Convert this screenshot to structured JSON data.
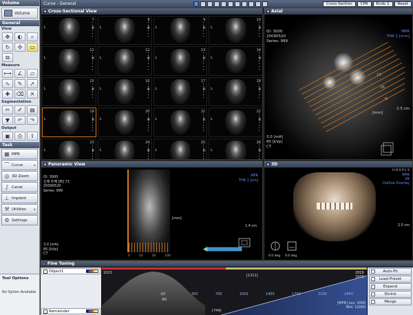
{
  "left_panel": {
    "volume_header": "Volume",
    "volume_button": "Volume",
    "general_header": "General",
    "view_label": "View",
    "measure_label": "Measure",
    "segmentation_label": "Segmentation",
    "output_label": "Output",
    "task_header": "Task",
    "tasks": [
      {
        "label": "MPR"
      },
      {
        "label": "Curve"
      },
      {
        "label": "3D Zoom"
      },
      {
        "label": "Canal"
      },
      {
        "label": "Implant"
      },
      {
        "label": "Utilities"
      },
      {
        "label": "Settings"
      }
    ],
    "tool_options_title": "Tool Options",
    "tool_options_text": "No Option Available"
  },
  "topbar": {
    "title": "Curve - General",
    "mode_buttons": [
      "Cross-Section",
      "CPR",
      "Endo 1",
      "Reset"
    ]
  },
  "cross_section": {
    "title": "Cross-Sectional View",
    "numbers": [
      "7",
      "8",
      "9",
      "10",
      "11",
      "12",
      "13",
      "14",
      "15",
      "16",
      "17",
      "18",
      "19",
      "20",
      "21",
      "22",
      "23",
      "24",
      "25",
      "26"
    ],
    "left_label": "L",
    "right_label": "B"
  },
  "axial": {
    "title": "Axial",
    "id_line": "ID: 3000",
    "date_line": "20090520",
    "series_line": "Series: 999",
    "mpr": "MPR",
    "thk": "THK 1 [mm]",
    "mm": "[mm]",
    "scale": "2.5 cm",
    "ma": "3.0 [mA]",
    "kvp": "85 [kVp]",
    "ct": "CT",
    "slice_numbers": [
      "16",
      "36",
      "N"
    ]
  },
  "panoramic": {
    "title": "Panoramic View",
    "id_line": "ID: 3000",
    "name_line": "신체 두께 [M] 73",
    "date_line": "20090520",
    "series_line": "Series: 999",
    "mpr": "MPR",
    "thk": "THK 1 [cm]",
    "mm": "[mm]",
    "scale": "1.4 cm",
    "ma": "3.0 [mA]",
    "kvp": "85 [kVp]",
    "ct": "CT",
    "ruler_ticks": [
      "0",
      "10",
      "20",
      "100"
    ]
  },
  "vr": {
    "title": "3D",
    "header_right": "H R A P L S",
    "mpr": "MPR",
    "thk": "VR",
    "overlay": "Outline Overlay",
    "scale": "2.5 cm",
    "angle_a": "0.0 deg",
    "angle_b": "0.0 deg"
  },
  "fine_tuning": {
    "title": "Fine Tuning",
    "object": "Object1",
    "remainder": "Remainder",
    "window_top_left": "1023",
    "window_top_center": "[1311]",
    "window_top_right": "2829",
    "window_right_top": "2000",
    "peak_values": [
      "-20",
      "-80"
    ],
    "axis_ticks": [
      "350",
      "700",
      "1050",
      "1400",
      "1750",
      "2100",
      "2450"
    ],
    "bottom_center": "[744]",
    "level_line": "[MPR] Lev: 3000",
    "width_line": "Wid: 12000",
    "buttons": [
      "Auto-Fit",
      "Load Preset",
      "Expand",
      "Shrink",
      "Merge"
    ]
  },
  "colors": {
    "accent_orange": "#d87a1c",
    "overlay_blue": "#6d8cff",
    "header_bg": "#45526a"
  }
}
